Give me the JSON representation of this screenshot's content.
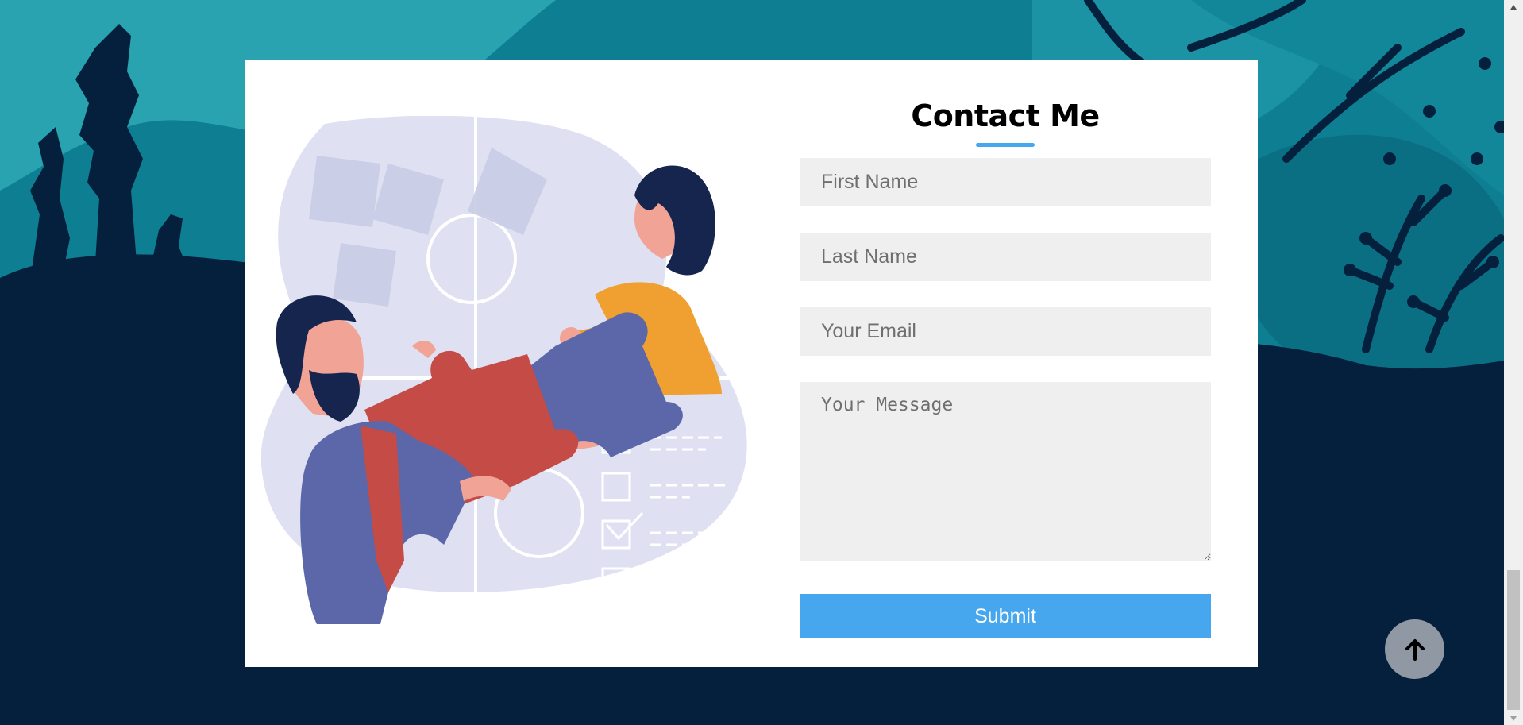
{
  "contact": {
    "title": "Contact Me",
    "first_name_placeholder": "First Name",
    "last_name_placeholder": "Last Name",
    "email_placeholder": "Your Email",
    "message_placeholder": "Your Message",
    "submit_label": "Submit"
  },
  "icons": {
    "scroll_top": "arrow-up-icon",
    "scrollbar_up": "triangle-up-icon",
    "scrollbar_down": "triangle-down-icon"
  },
  "colors": {
    "accent": "#46a6ee",
    "background_dark": "#04203d",
    "background_teal": "#0e7f93",
    "card": "#ffffff",
    "field": "#efefef",
    "scroll_button": "#8f98a3"
  }
}
